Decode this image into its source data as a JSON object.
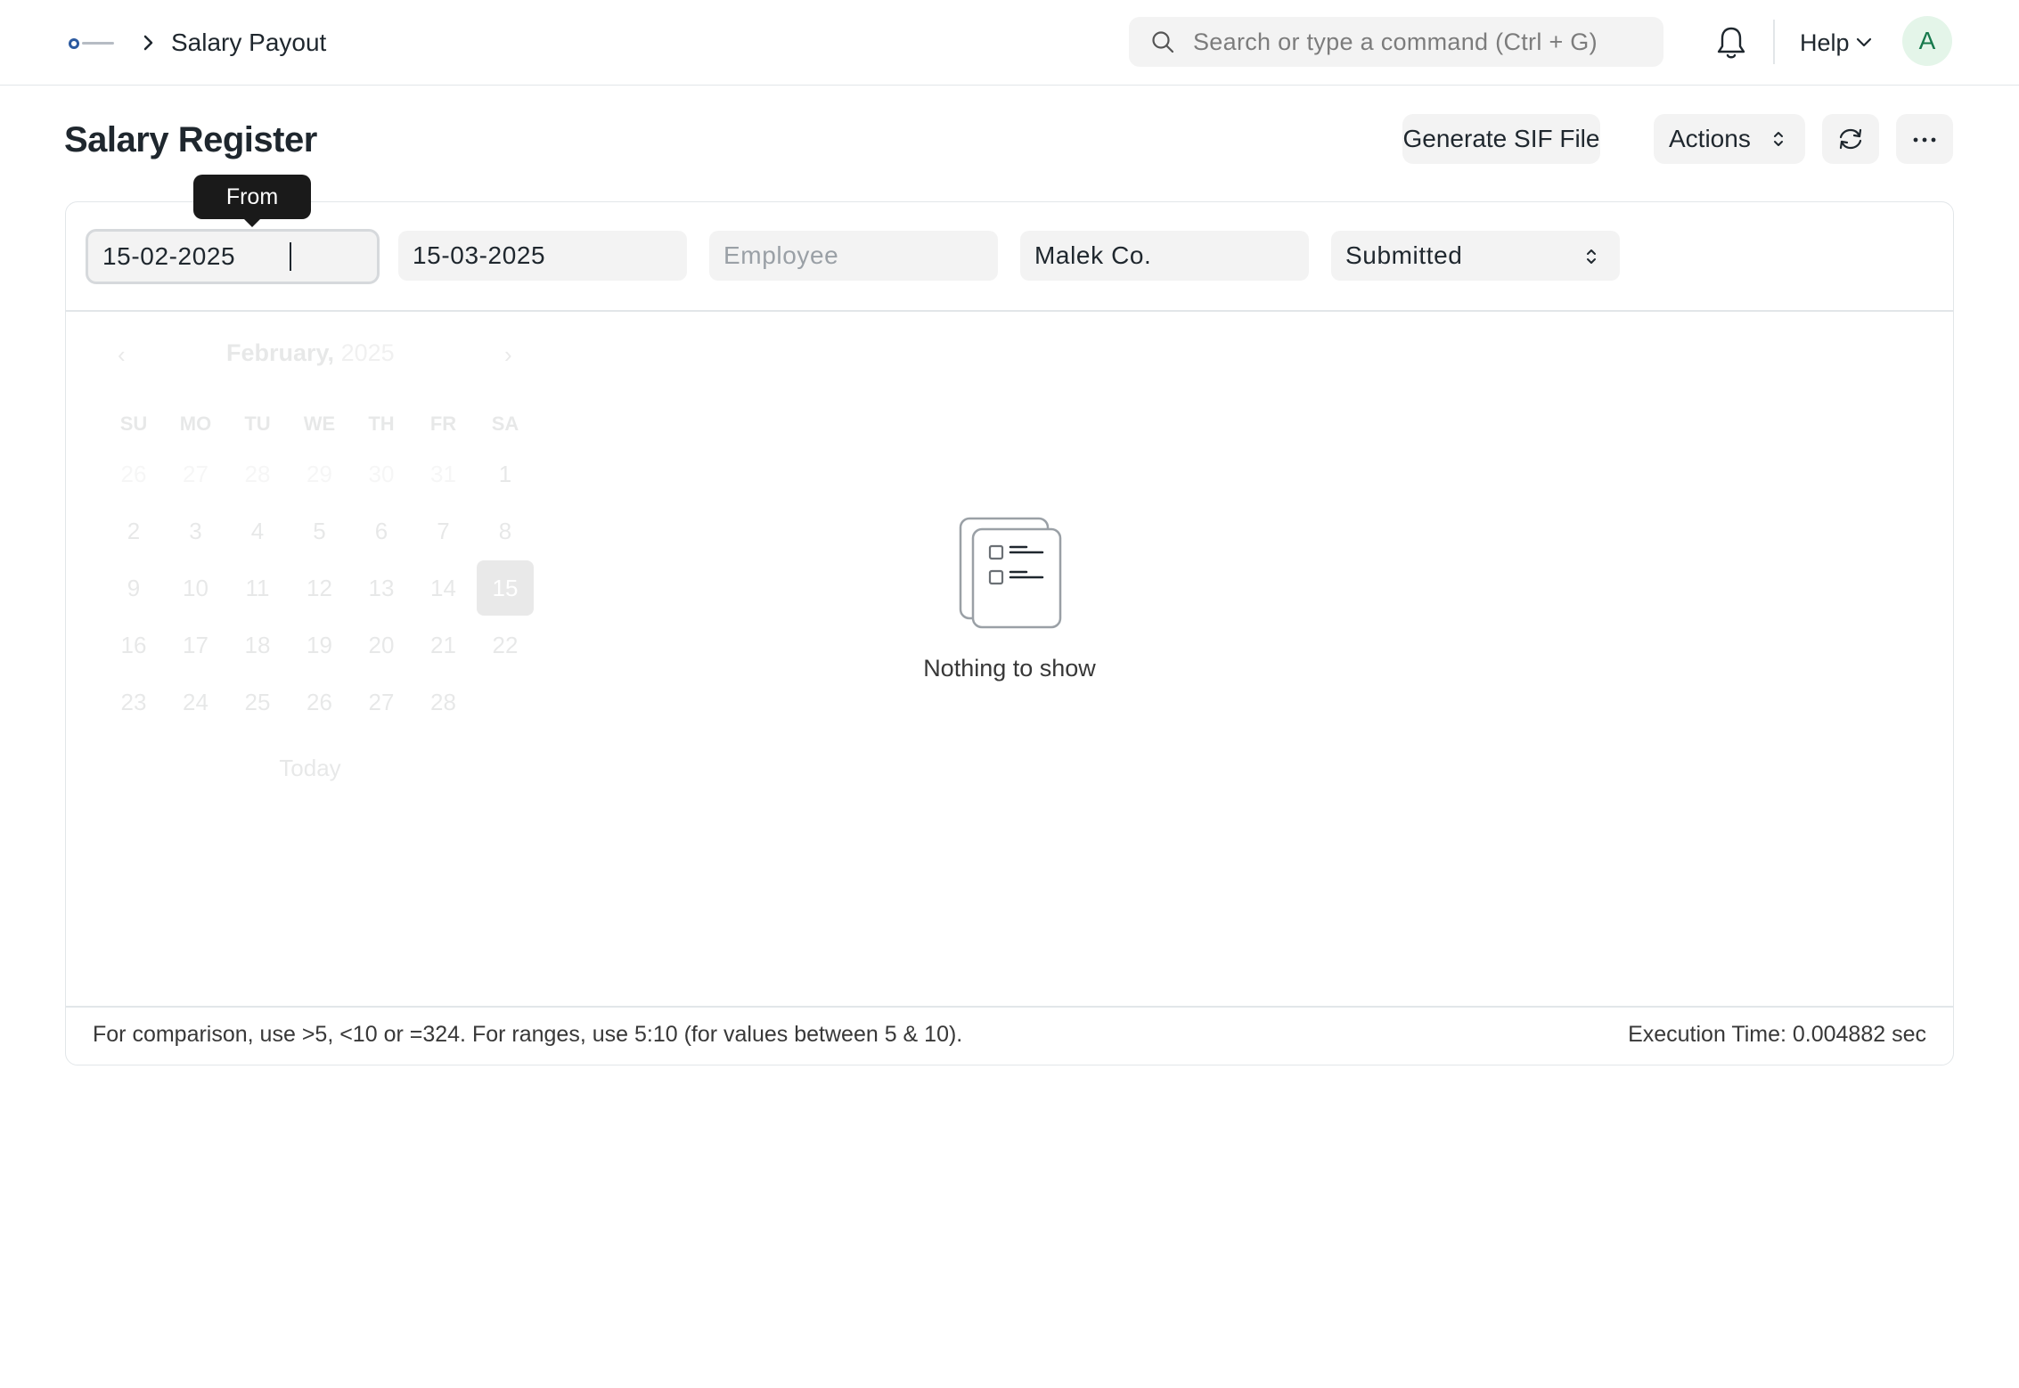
{
  "navbar": {
    "breadcrumb": "Salary Payout",
    "search_placeholder": "Search or type a command (Ctrl + G)",
    "help_label": "Help",
    "avatar_initial": "A"
  },
  "page": {
    "title": "Salary Register",
    "generate_sif_label": "Generate SIF File",
    "actions_label": "Actions"
  },
  "filters": {
    "from_tooltip": "From",
    "from_date": "15-02-2025",
    "to_date": "15-03-2025",
    "employee_placeholder": "Employee",
    "company": "Malek Co.",
    "docstatus": "Submitted"
  },
  "datepicker": {
    "prev": "‹",
    "next": "›",
    "month": "February,",
    "year": "2025",
    "weekdays": [
      "SU",
      "MO",
      "TU",
      "WE",
      "TH",
      "FR",
      "SA"
    ],
    "days": [
      "26",
      "27",
      "28",
      "29",
      "30",
      "31",
      "1",
      "2",
      "3",
      "4",
      "5",
      "6",
      "7",
      "8",
      "9",
      "10",
      "11",
      "12",
      "13",
      "14",
      "15",
      "16",
      "17",
      "18",
      "19",
      "20",
      "21",
      "22",
      "23",
      "24",
      "25",
      "26",
      "27",
      "28"
    ],
    "selected_day": "15",
    "today_label": "Today"
  },
  "empty_state": {
    "message": "Nothing to show"
  },
  "footer": {
    "note": "For comparison, use >5, <10 or =324. For ranges, use 5:10 (for values between 5 & 10).",
    "execution_time": "Execution Time: 0.004882 sec"
  },
  "colors": {
    "background": "#ffffff",
    "input_bg": "#f3f3f3",
    "border": "#e2e6e9",
    "text": "#1f272e",
    "avatar_bg": "#e4f5e9",
    "avatar_text": "#16794c",
    "tooltip_bg": "#1a1a1a"
  }
}
